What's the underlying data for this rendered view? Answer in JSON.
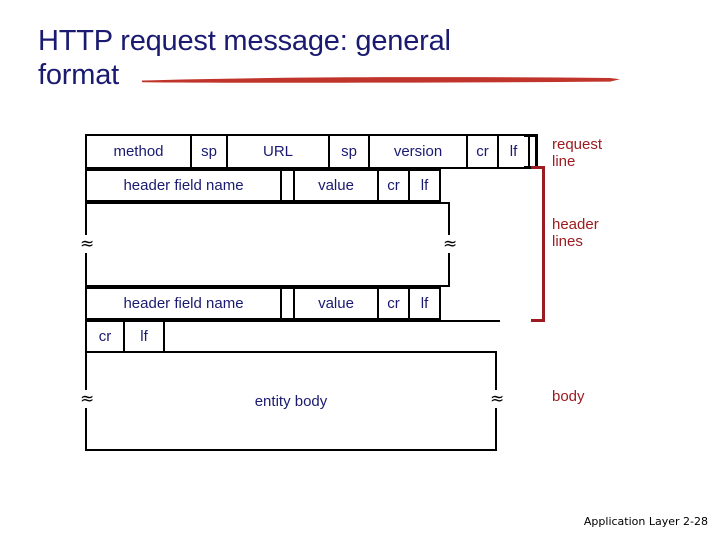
{
  "slide": {
    "title": "HTTP request message: general\nformat",
    "footer": "Application Layer 2-28",
    "title_color": "#1a1a70",
    "accent_color": "#c0342b",
    "annotation_color": "#9c1b20",
    "text_color": "#1a1a70"
  },
  "diagram": {
    "request_line": {
      "cells": [
        {
          "label": "method"
        },
        {
          "label": "sp"
        },
        {
          "label": "URL"
        },
        {
          "label": "sp"
        },
        {
          "label": "version"
        },
        {
          "label": "cr"
        },
        {
          "label": "lf"
        }
      ]
    },
    "header_line_first": {
      "cells": [
        {
          "label": "header field name"
        },
        {
          "label": ""
        },
        {
          "label": "value"
        },
        {
          "label": "cr"
        },
        {
          "label": "lf"
        }
      ]
    },
    "header_line_last": {
      "cells": [
        {
          "label": "header field name"
        },
        {
          "label": ""
        },
        {
          "label": "value"
        },
        {
          "label": "cr"
        },
        {
          "label": "lf"
        }
      ]
    },
    "blank_line": {
      "cells": [
        {
          "label": "cr"
        },
        {
          "label": "lf"
        }
      ]
    },
    "entity_body": {
      "label": "entity body"
    },
    "continuation_mark": "≈"
  },
  "annotations": [
    {
      "label": "request\nline"
    },
    {
      "label": "header\nlines"
    },
    {
      "label": "body"
    }
  ]
}
